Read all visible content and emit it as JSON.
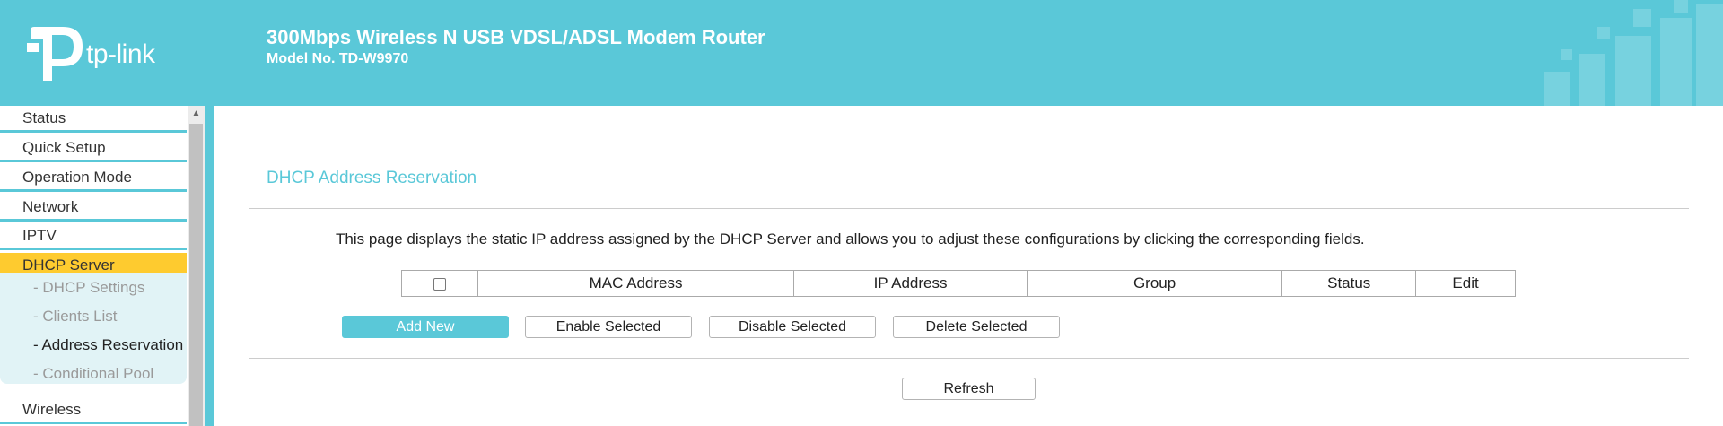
{
  "header": {
    "logo_text": "tp-link",
    "product_name": "300Mbps Wireless N USB VDSL/ADSL Modem Router",
    "model": "Model No. TD-W9970"
  },
  "sidebar": {
    "items": [
      {
        "label": "Status"
      },
      {
        "label": "Quick Setup"
      },
      {
        "label": "Operation Mode"
      },
      {
        "label": "Network"
      },
      {
        "label": "IPTV"
      },
      {
        "label": "DHCP Server"
      },
      {
        "label": "Wireless"
      }
    ],
    "subitems": [
      {
        "label": "- DHCP Settings"
      },
      {
        "label": "- Clients List"
      },
      {
        "label": "- Address Reservation"
      },
      {
        "label": "- Conditional Pool"
      }
    ]
  },
  "main": {
    "title": "DHCP Address Reservation",
    "description": "This page displays the static IP address assigned by the DHCP Server and allows you to adjust these configurations by clicking the corresponding fields.",
    "table": {
      "columns": [
        "MAC Address",
        "IP Address",
        "Group",
        "Status",
        "Edit"
      ]
    },
    "buttons": {
      "add_new": "Add New",
      "enable_selected": "Enable Selected",
      "disable_selected": "Disable Selected",
      "delete_selected": "Delete Selected",
      "refresh": "Refresh"
    }
  },
  "colors": {
    "accent": "#5ac8d8",
    "active_menu": "#fecb2f",
    "submenu_bg": "#e1f3f6"
  }
}
